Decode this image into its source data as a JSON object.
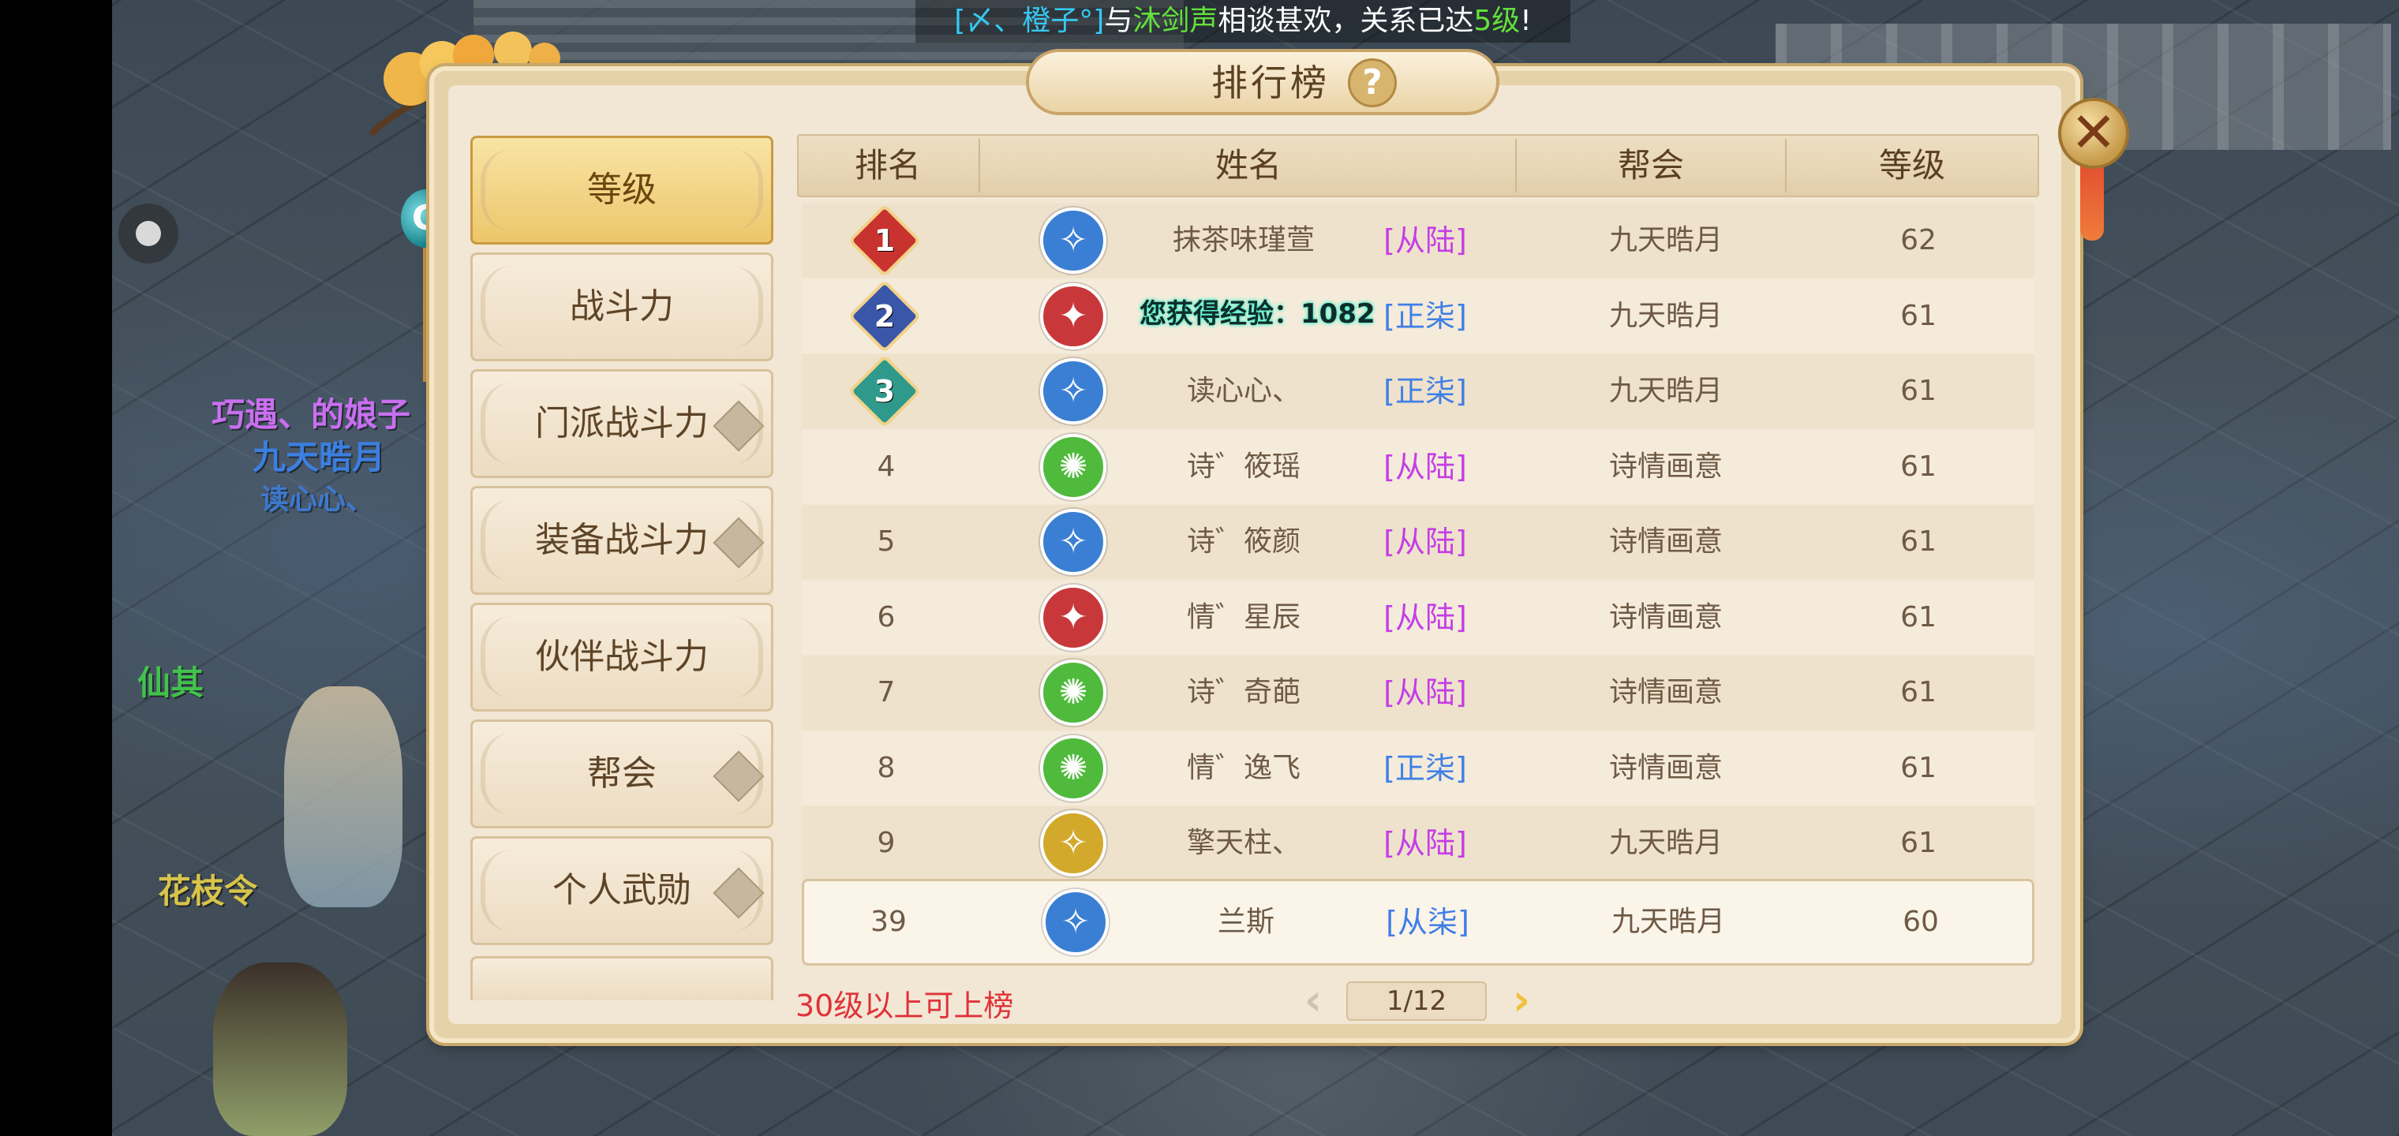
{
  "notice": {
    "prefix": "[〆、橙子°]",
    "mid": "与",
    "name": "沐剑声",
    "suffix": "相谈甚欢，关系已达",
    "level": "5级",
    "end": "!"
  },
  "panel": {
    "title": "排行榜",
    "help_label": "?",
    "close_label": "✕"
  },
  "tabs": [
    {
      "label": "等级",
      "active": true,
      "expandable": false
    },
    {
      "label": "战斗力",
      "active": false,
      "expandable": false
    },
    {
      "label": "门派战斗力",
      "active": false,
      "expandable": true
    },
    {
      "label": "装备战斗力",
      "active": false,
      "expandable": true
    },
    {
      "label": "伙伴战斗力",
      "active": false,
      "expandable": false
    },
    {
      "label": "帮会",
      "active": false,
      "expandable": true
    },
    {
      "label": "个人武勋",
      "active": false,
      "expandable": true
    }
  ],
  "table": {
    "headers": [
      "排名",
      "姓名",
      "帮会",
      "等级"
    ],
    "rows": [
      {
        "rank": "1",
        "school": "blue",
        "name": "抹茶味瑾萱",
        "tag": "[从陆]",
        "tag_color": "purple",
        "guild": "九天晧月",
        "level": "62"
      },
      {
        "rank": "2",
        "school": "red",
        "name": "",
        "tag": "[正柒]",
        "tag_color": "blue",
        "guild": "九天晧月",
        "level": "61"
      },
      {
        "rank": "3",
        "school": "blue",
        "name": "读心心、",
        "tag": "[正柒]",
        "tag_color": "blue",
        "guild": "九天晧月",
        "level": "61"
      },
      {
        "rank": "4",
        "school": "green",
        "name": "诗゛筱瑶",
        "tag": "[从陆]",
        "tag_color": "purple",
        "guild": "诗情画意",
        "level": "61"
      },
      {
        "rank": "5",
        "school": "blue",
        "name": "诗゛筱颜",
        "tag": "[从陆]",
        "tag_color": "purple",
        "guild": "诗情画意",
        "level": "61"
      },
      {
        "rank": "6",
        "school": "red",
        "name": "情゛星辰",
        "tag": "[从陆]",
        "tag_color": "purple",
        "guild": "诗情画意",
        "level": "61"
      },
      {
        "rank": "7",
        "school": "green",
        "name": "诗゛奇葩",
        "tag": "[从陆]",
        "tag_color": "purple",
        "guild": "诗情画意",
        "level": "61"
      },
      {
        "rank": "8",
        "school": "green",
        "name": "情゛逸飞",
        "tag": "[正柒]",
        "tag_color": "blue",
        "guild": "诗情画意",
        "level": "61"
      },
      {
        "rank": "9",
        "school": "gold",
        "name": "擎天柱、",
        "tag": "[从陆]",
        "tag_color": "purple",
        "guild": "九天晧月",
        "level": "61"
      }
    ],
    "self_row": {
      "rank": "39",
      "school": "blue",
      "name": "兰斯",
      "tag": "[从柒]",
      "tag_color": "blue",
      "guild": "九天晧月",
      "level": "60"
    }
  },
  "exp_popup": "您获得经验：1082",
  "footer": {
    "requirement": "30级以上可上榜",
    "page": "1/12",
    "prev": "‹",
    "next": "›"
  },
  "world_names": [
    {
      "text": "巧遇、的娘子",
      "color": "purple"
    },
    {
      "text": "九天晧月",
      "color": "blue"
    },
    {
      "text": "读心心、",
      "color": "blue"
    },
    {
      "text": "花枝令",
      "color": "yellow"
    },
    {
      "text": "仙其",
      "color": "green"
    }
  ],
  "colors": {
    "tag_purple": "#c43ee6",
    "tag_blue": "#3f7fe6",
    "school_blue": "#3a7fd3",
    "school_red": "#c8383a",
    "school_green": "#4fba3c",
    "school_gold": "#d3a92c",
    "medal_1": "#c9332f",
    "medal_2": "#3a56a8",
    "medal_3": "#2f9a8c"
  }
}
